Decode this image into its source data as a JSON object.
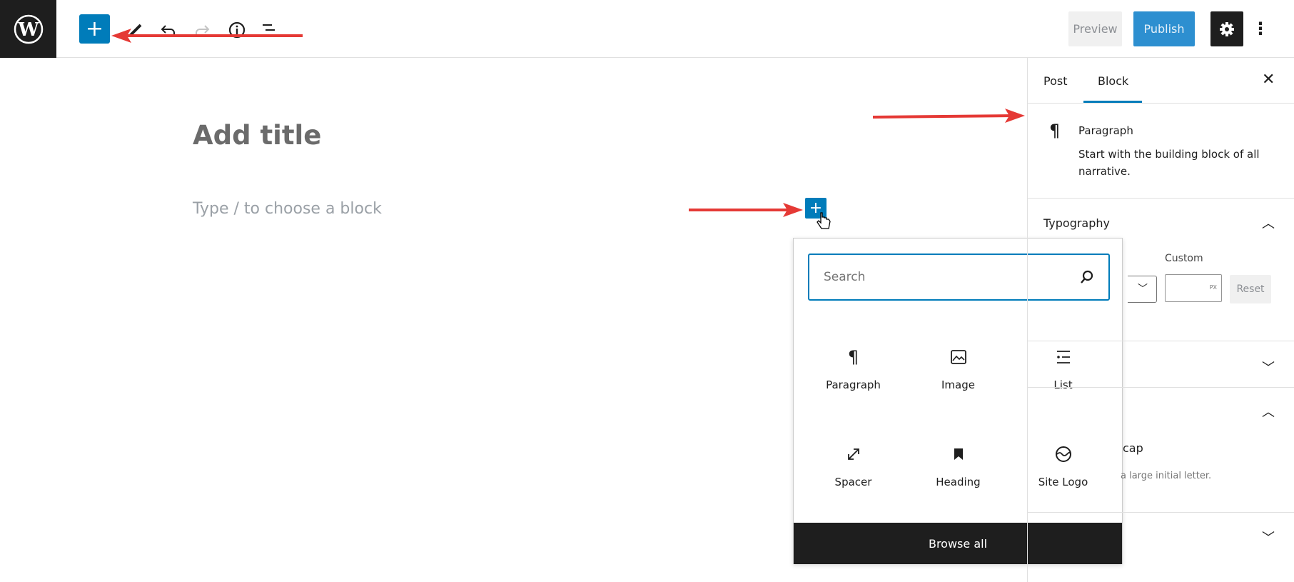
{
  "topbar": {
    "logo": "WordPress",
    "tools": [
      "add-block",
      "tools",
      "undo",
      "redo",
      "details",
      "list-view"
    ],
    "preview_label": "Preview",
    "publish_label": "Publish"
  },
  "editor": {
    "title_placeholder": "Add title",
    "block_placeholder": "Type / to choose a block"
  },
  "inserter": {
    "search_placeholder": "Search",
    "blocks": [
      {
        "label": "Paragraph",
        "icon": "paragraph-icon"
      },
      {
        "label": "Image",
        "icon": "image-icon"
      },
      {
        "label": "List",
        "icon": "list-icon"
      },
      {
        "label": "Spacer",
        "icon": "spacer-icon"
      },
      {
        "label": "Heading",
        "icon": "heading-icon"
      },
      {
        "label": "Site Logo",
        "icon": "site-logo-icon"
      }
    ],
    "browse_all": "Browse all"
  },
  "sidebar": {
    "tabs": [
      "Post",
      "Block"
    ],
    "active_tab": "Block",
    "block_name": "Paragraph",
    "block_desc_1": "Start with the building block of all",
    "block_desc_2": "narrative.",
    "typography": "Typography",
    "custom_label": "Custom",
    "unit": "PX",
    "reset_label": "Reset",
    "dropcap_fragment": "cap",
    "dropcap_desc_fragment": "a large initial letter."
  },
  "colors": {
    "accent": "#007cba",
    "annotation_arrow": "#e53935",
    "dark": "#1e1e1e"
  }
}
